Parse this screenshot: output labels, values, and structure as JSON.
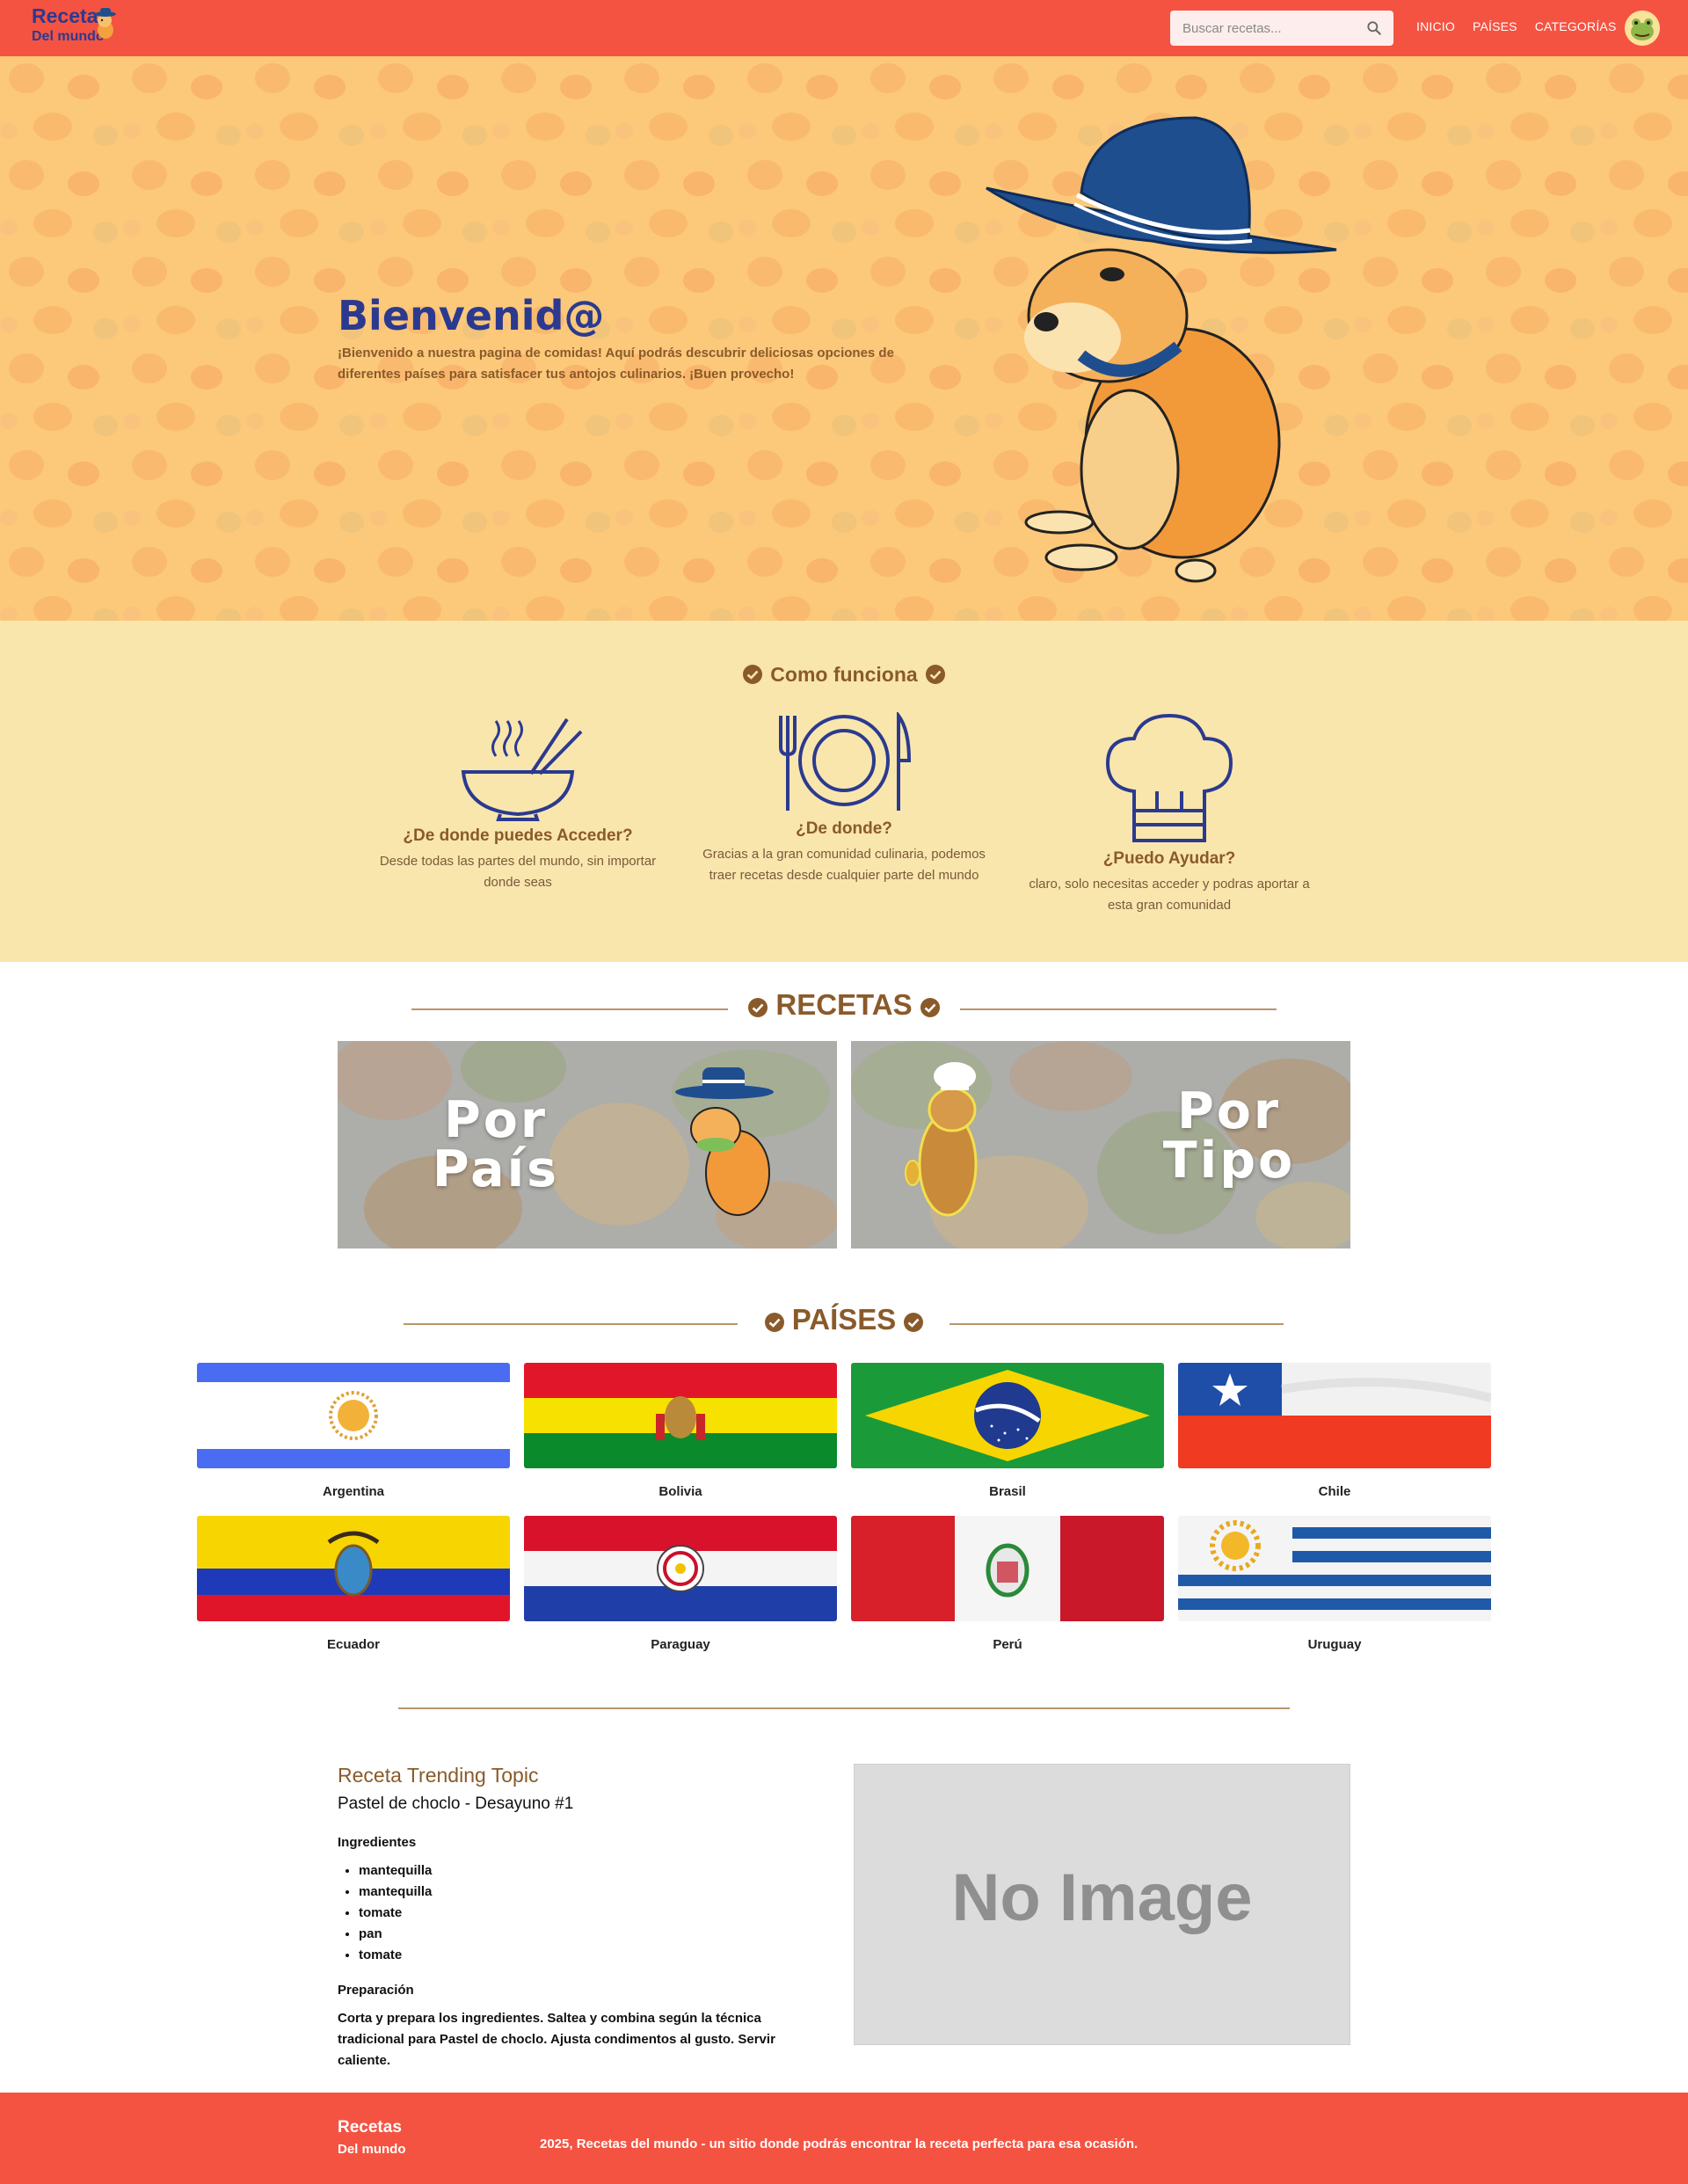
{
  "header": {
    "brand_title": "Recetas",
    "brand_subtitle": "Del mundo",
    "search_placeholder": "Buscar recetas...",
    "nav": [
      "INICIO",
      "PAÍSES",
      "CATEGORÍAS"
    ]
  },
  "hero": {
    "title": "Bienvenid@",
    "text": "¡Bienvenido a nuestra pagina de comidas! Aquí podrás descubrir deliciosas opciones de diferentes países para satisfacer tus antojos culinarios. ¡Buen provecho!"
  },
  "how": {
    "heading": "Como funciona",
    "items": [
      {
        "icon": "bowl-chopsticks-icon",
        "title": "¿De donde puedes Acceder?",
        "desc": "Desde todas las partes del mundo, sin importar donde seas"
      },
      {
        "icon": "plate-cutlery-icon",
        "title": "¿De donde?",
        "desc": "Gracias a la gran comunidad culinaria, podemos traer recetas desde cualquier parte del mundo"
      },
      {
        "icon": "chef-hat-icon",
        "title": "¿Puedo Ayudar?",
        "desc": "claro, solo necesitas acceder y podras aportar a esta gran comunidad"
      }
    ]
  },
  "recetas": {
    "heading": "RECETAS",
    "cards": [
      {
        "line1": "Por",
        "line2": "País"
      },
      {
        "line1": "Por",
        "line2": "Tipo"
      }
    ]
  },
  "paises": {
    "heading": "PAÍSES",
    "countries": [
      "Argentina",
      "Bolivia",
      "Brasil",
      "Chile",
      "Ecuador",
      "Paraguay",
      "Perú",
      "Uruguay"
    ]
  },
  "trending": {
    "label": "Receta Trending Topic",
    "title": "Pastel de choclo - Desayuno #1",
    "ingredients_heading": "Ingredientes",
    "ingredients": [
      "mantequilla",
      "mantequilla",
      "tomate",
      "pan",
      "tomate"
    ],
    "preparation_heading": "Preparación",
    "preparation": "Corta y prepara los ingredientes. Saltea y combina según la técnica tradicional para Pastel de choclo. Ajusta condimentos al gusto. Servir caliente.",
    "image_placeholder": "No Image"
  },
  "footer": {
    "brand_title": "Recetas",
    "brand_subtitle": "Del mundo",
    "text": "2025, Recetas del mundo - un sitio donde podrás encontrar la receta perfecta para esa ocasión."
  },
  "colors": {
    "header_bg": "#f55342",
    "hero_bg": "#fcc87a",
    "how_bg": "#f9e6ad",
    "heading_brown": "#8a5a2a",
    "brand_blue": "#2b3a8f"
  }
}
